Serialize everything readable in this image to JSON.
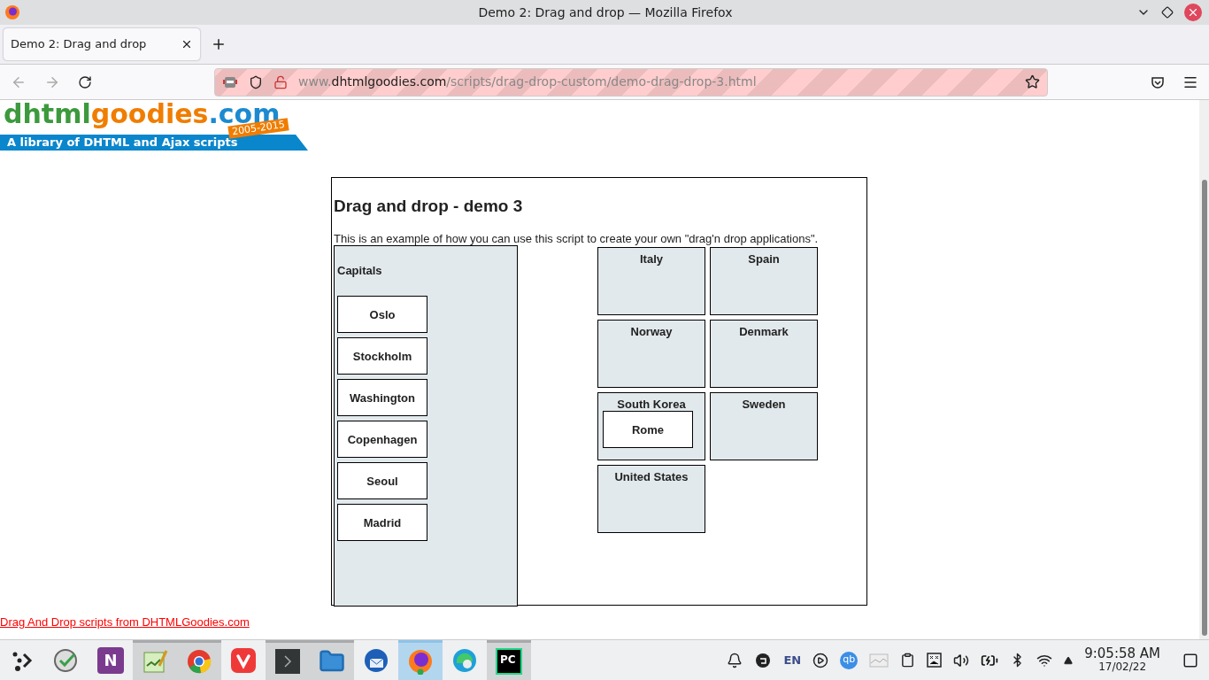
{
  "window": {
    "title": "Demo 2: Drag and drop — Mozilla Firefox"
  },
  "tabs": [
    {
      "label": "Demo 2: Drag and drop",
      "selected": true
    }
  ],
  "address_bar": {
    "host_prefix": "www.",
    "domain": "dhtmlgoodies.com",
    "path": "/scripts/drag-drop-custom/demo-drag-drop-3.html"
  },
  "logo": {
    "parts": [
      {
        "text": "dhtml",
        "color": "#3c9a3c"
      },
      {
        "text": "goodies",
        "color": "#f07d00"
      },
      {
        "text": ".com",
        "color": "#1b8ad0"
      }
    ],
    "tagline": "A library of DHTML and Ajax scripts",
    "years": "2005-2015"
  },
  "demo": {
    "heading": "Drag and drop - demo 3",
    "description": "This is an example of how you can use this script to create your own \"drag'n drop applications\".",
    "capitals": {
      "title": "Capitals",
      "items": [
        "Oslo",
        "Stockholm",
        "Washington",
        "Copenhagen",
        "Seoul",
        "Madrid"
      ]
    },
    "countries": [
      {
        "name": "Italy"
      },
      {
        "name": "Spain"
      },
      {
        "name": "Norway"
      },
      {
        "name": "Denmark"
      },
      {
        "name": "South Korea",
        "items": [
          "Rome"
        ]
      },
      {
        "name": "Sweden"
      },
      {
        "name": "United States"
      }
    ]
  },
  "footer_link": "Drag And Drop scripts from DHTMLGoodies.com",
  "taskbar": {
    "apps": [
      {
        "kind": "launcher",
        "running": false,
        "selected": false
      },
      {
        "kind": "clock",
        "running": false,
        "selected": false
      },
      {
        "kind": "onenote",
        "running": false,
        "selected": false,
        "letter": "N"
      },
      {
        "kind": "editor",
        "running": true,
        "selected": false
      },
      {
        "kind": "chrome",
        "running": true,
        "selected": false
      },
      {
        "kind": "vivaldi",
        "running": false,
        "selected": false
      },
      {
        "kind": "terminal",
        "running": true,
        "selected": false
      },
      {
        "kind": "files",
        "running": true,
        "selected": false
      },
      {
        "kind": "thunderbird",
        "running": false,
        "selected": false
      },
      {
        "kind": "firefox",
        "running": true,
        "selected": true
      },
      {
        "kind": "edge",
        "running": false,
        "selected": false
      },
      {
        "kind": "pycharm",
        "running": true,
        "selected": false,
        "letter": "PC"
      }
    ],
    "tray": {
      "language": "EN",
      "qb": "qb"
    },
    "clock": {
      "time": "9:05:58 AM",
      "date": "17/02/22"
    }
  }
}
